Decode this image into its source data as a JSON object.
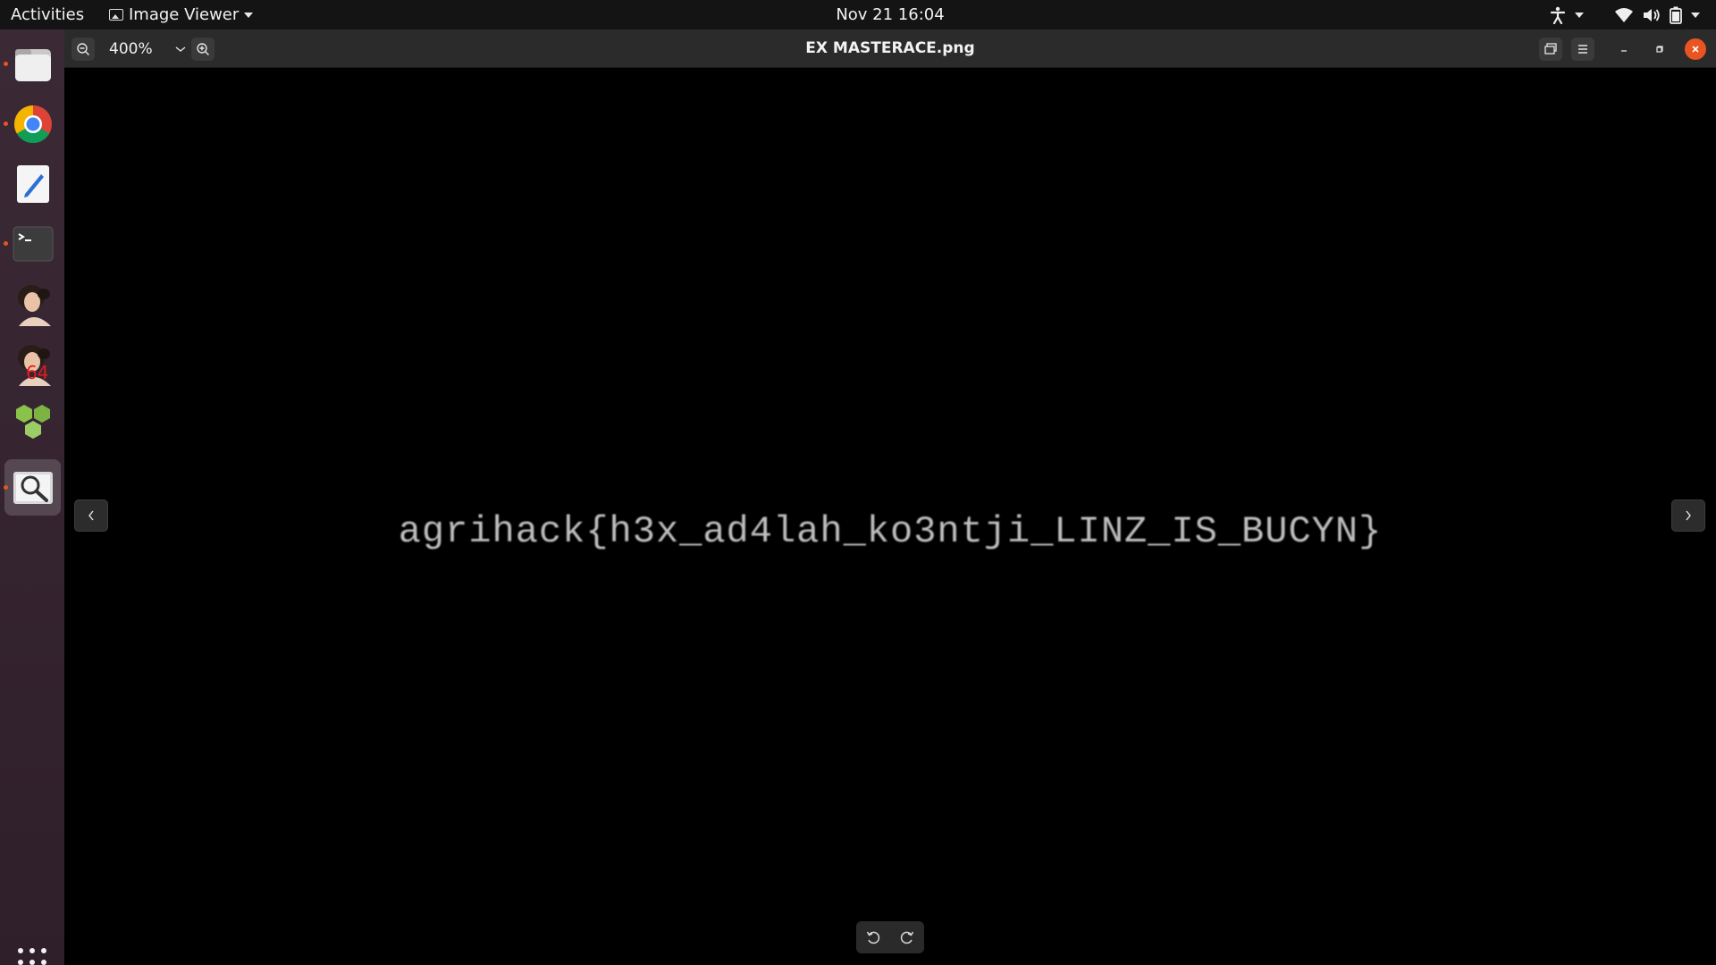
{
  "topbar": {
    "activities": "Activities",
    "app_name": "Image Viewer",
    "clock": "Nov 21  16:04"
  },
  "dock": {
    "items": [
      {
        "name": "Files",
        "icon": "files-icon",
        "running": true
      },
      {
        "name": "Google Chrome",
        "icon": "chrome-icon",
        "running": true
      },
      {
        "name": "Text Editor",
        "icon": "text-editor-icon",
        "running": false
      },
      {
        "name": "Terminal",
        "icon": "terminal-icon",
        "running": true
      },
      {
        "name": "Portrait App",
        "icon": "portrait-icon",
        "running": false
      },
      {
        "name": "Portrait App 64",
        "icon": "portrait-64-icon",
        "badge": "64",
        "running": false
      },
      {
        "name": "Hex App",
        "icon": "hexagons-icon",
        "running": false
      },
      {
        "name": "Image Viewer",
        "icon": "image-viewer-icon",
        "running": true,
        "active": true
      }
    ],
    "show_apps": "show-apps-icon"
  },
  "window": {
    "title": "EX MASTERACE.png",
    "zoom_level": "400%"
  },
  "image": {
    "text": "agrihack{h3x_ad4lah_ko3ntji_LINZ_IS_BUCYN}"
  },
  "colors": {
    "accent_close": "#e95420",
    "dock_bg": "#3b2a36",
    "topbar_bg": "#141414",
    "headerbar_bg": "#2b2b2b"
  }
}
